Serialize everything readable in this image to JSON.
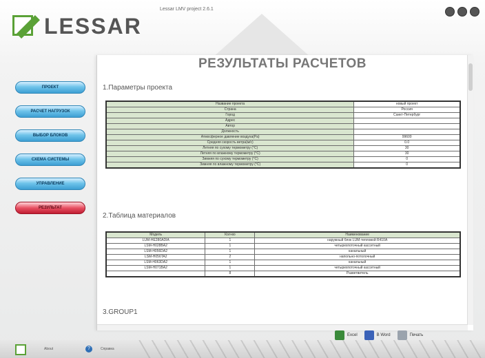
{
  "header": {
    "logo_text": "LESSAR",
    "app_title": "Lessar LMV project 2.6.1",
    "window_controls": [
      "minimize-icon",
      "maximize-icon",
      "close-icon"
    ]
  },
  "sidebar": {
    "items": [
      {
        "label": "ПРОЕКТ",
        "active": false
      },
      {
        "label": "РАСЧЕТ НАГРУЗОК",
        "active": false
      },
      {
        "label": "ВЫБОР БЛОКОВ",
        "active": false
      },
      {
        "label": "СХЕМА СИСТЕМЫ",
        "active": false
      },
      {
        "label": "УПРАВЛЕНИЕ",
        "active": false
      },
      {
        "label": "РЕЗУЛЬТАТ",
        "active": true
      }
    ]
  },
  "main": {
    "heading": "РЕЗУЛЬТАТЫ РАСЧЕТОВ",
    "section1_title": "1.Параметры проекта",
    "params": [
      {
        "label": "Название проекта",
        "value": "новый проект"
      },
      {
        "label": "Страна",
        "value": "Россия"
      },
      {
        "label": "Город",
        "value": "Санкт-Петербург"
      },
      {
        "label": "Адрес",
        "value": ""
      },
      {
        "label": "Автор",
        "value": ""
      },
      {
        "label": "Должность",
        "value": ""
      },
      {
        "label": "Атмосферное давление воздуха(Pa)",
        "value": "99600"
      },
      {
        "label": "Средняя скорость ветра(м/с)",
        "value": "0.0"
      },
      {
        "label": "Летняя по сухому термометру (°C)",
        "value": "30"
      },
      {
        "label": "Летняя по влажному термометру (°C)",
        "value": "30"
      },
      {
        "label": "Зимняя по сухому термометру (°C)",
        "value": "0"
      },
      {
        "label": "Зимняя по влажному термометру (°C)",
        "value": "0"
      }
    ],
    "section2_title": "2.Таблица материалов",
    "materials_headers": [
      "Модель",
      "Кол-во",
      "Наименование"
    ],
    "materials": [
      {
        "model": "LUM-HE280ADIA",
        "qty": "1",
        "name": "наружный блок LUM-тепловой R410A"
      },
      {
        "model": "LSM-H028BA2",
        "qty": "1",
        "name": "четырехпоточный кассетный"
      },
      {
        "model": "LSM-H056DA2",
        "qty": "1",
        "name": "канальный"
      },
      {
        "model": "LSM-H056TA2",
        "qty": "2",
        "name": "напольно-потолочный"
      },
      {
        "model": "LSM-H063DA2",
        "qty": "1",
        "name": "канальный"
      },
      {
        "model": "LSM-H071BA2",
        "qty": "1",
        "name": "четырехпоточный кассетный"
      },
      {
        "model": "",
        "qty": "8",
        "name": "Разветвитель"
      }
    ],
    "section3_title": "3.GROUP1"
  },
  "toolbar": {
    "excel_label": "Excel",
    "word_label": "В Word",
    "print_label": "Печать"
  },
  "footer": {
    "about_label": "About",
    "help_label": "Справка"
  }
}
